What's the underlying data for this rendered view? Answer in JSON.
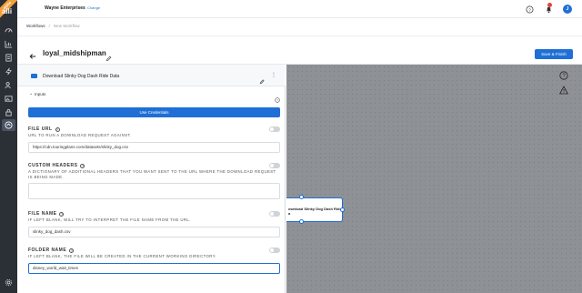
{
  "brand": {
    "ribbon": "alpha",
    "logo": "alli"
  },
  "topbar": {
    "org_name": "Wayne Enterprises",
    "change_label": "Change",
    "avatar_initial": "J"
  },
  "breadcrumb": {
    "root": "Workflows",
    "current": "New Workflow"
  },
  "workflow": {
    "title": "loyal_midshipman",
    "save_label": "Save & Finish"
  },
  "step": {
    "name": "Download Slinky Dog Dash Ride Data",
    "more": "⋮"
  },
  "inputs": {
    "header": "Inputs",
    "credentials_button": "Use Credentials",
    "fields": [
      {
        "label": "FILE URL",
        "description": "URL TO RUN A DOWNLOAD REQUEST AGAINST.",
        "value": "https://cdn.touringplans.com/datasets/slinky_dog.csv"
      },
      {
        "label": "CUSTOM HEADERS",
        "description": "A DICTIONARY OF ADDITIONAL HEADERS THAT YOU WANT SENT TO THE URL WHERE THE DOWNLOAD REQUEST IS BEING MADE.",
        "value": ""
      },
      {
        "label": "FILE NAME",
        "description": "IF LEFT BLANK, WILL TRY TO INTERPRET THE FILE NAME FROM THE URL.",
        "value": "slinky_dog_dash.csv"
      },
      {
        "label": "FOLDER NAME",
        "description": "IF LEFT BLANK, THE FILE WILL BE CREATED IN THE CURRENT WORKING DIRECTORY.",
        "value": "disney_world_wait_times"
      }
    ]
  },
  "canvas": {
    "node_label_line1": "ownload Slinky Dog Dash Ride",
    "node_label_line2": "a"
  },
  "colors": {
    "accent": "#1f6fd6",
    "rail": "#2b2f36",
    "canvas": "#8e9196",
    "badge": "#e0473b",
    "ribbon": "#f2a13b"
  },
  "icons": {
    "rail": [
      "dashboard-icon",
      "reports-icon",
      "documents-icon",
      "flash-icon",
      "users-icon",
      "image-icon",
      "lock-icon",
      "workflows-icon",
      "settings-icon"
    ],
    "topbar": [
      "help-icon",
      "bell-icon"
    ],
    "canvas": [
      "help-icon",
      "warning-icon"
    ]
  }
}
